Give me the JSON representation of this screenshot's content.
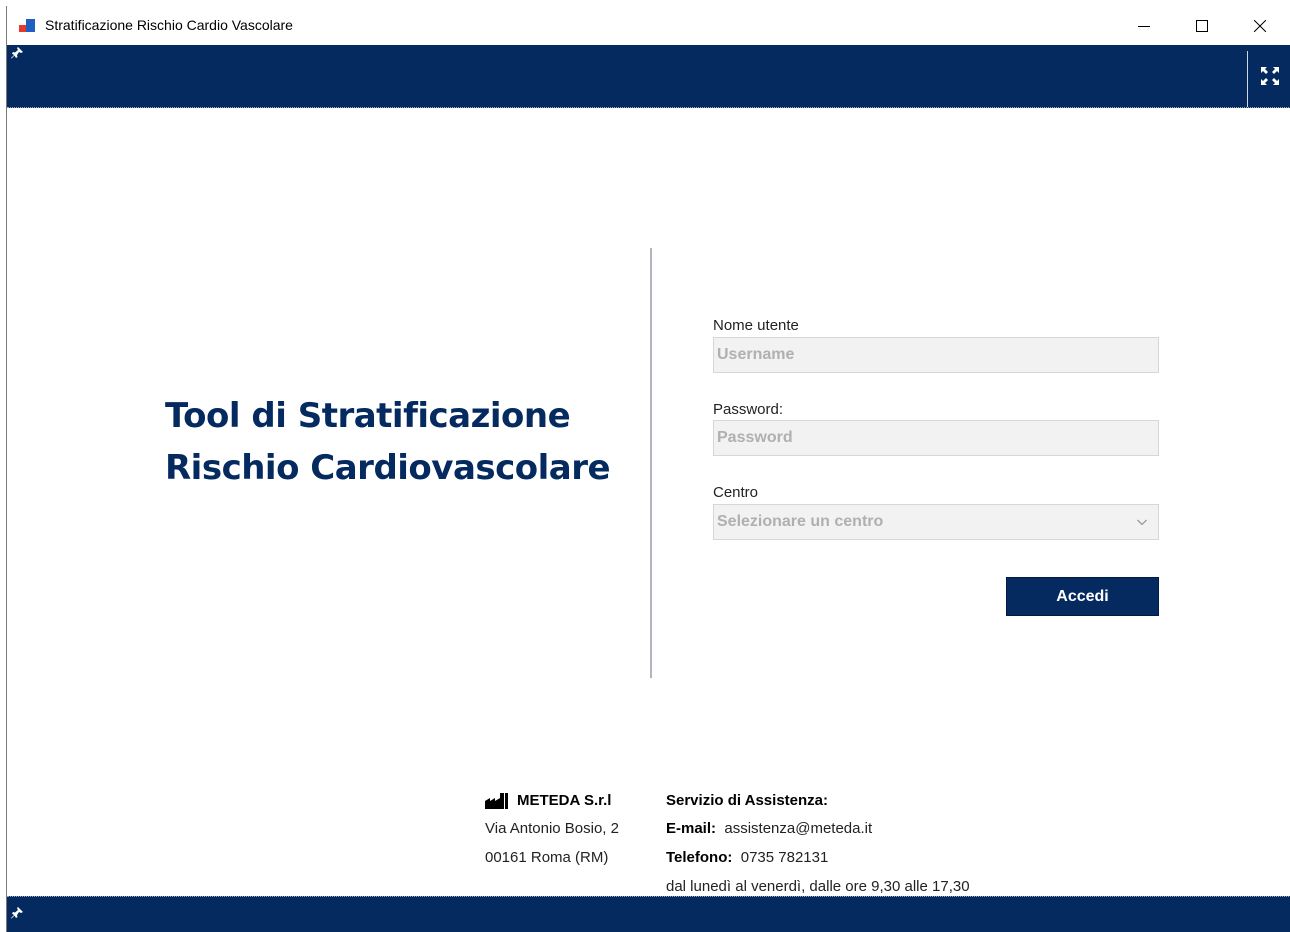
{
  "window": {
    "title": "Stratificazione Rischio Cardio Vascolare",
    "controls": [
      "minimize",
      "maximize",
      "close"
    ]
  },
  "colors": {
    "brand_navy": "#042a60",
    "divider": "#b4b4c0",
    "field_bg": "#f2f2f2"
  },
  "icons": {
    "app": "app-logo-icon",
    "pin": "pin-icon",
    "fullscreen": "fullscreen-icon",
    "company": "factory-icon",
    "select": "chevron-down-icon"
  },
  "hero": {
    "line1": "Tool di Stratificazione",
    "line2": "Rischio Cardiovascolare"
  },
  "form": {
    "username": {
      "label": "Nome utente",
      "placeholder": "Username",
      "value": ""
    },
    "password": {
      "label": "Password:",
      "placeholder": "Password",
      "value": ""
    },
    "centro": {
      "label": "Centro",
      "selected": "Selezionare un centro"
    },
    "submit_label": "Accedi"
  },
  "company": {
    "name": "METEDA S.r.l",
    "address_line1": "Via Antonio Bosio, 2",
    "address_line2": "00161 Roma (RM)"
  },
  "support": {
    "title": "Servizio di Assistenza:",
    "email_label": "E-mail:",
    "email": "assistenza@meteda.it",
    "phone_label": "Telefono:",
    "phone": "0735 782131",
    "hours": "dal lunedì al venerdì, dalle ore 9,30 alle 17,30"
  }
}
